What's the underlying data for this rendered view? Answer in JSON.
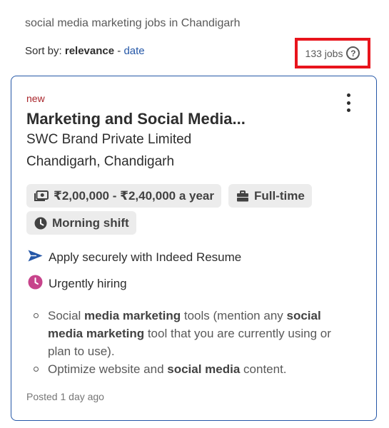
{
  "search": {
    "query": "social media marketing jobs in Chandigarh"
  },
  "sort": {
    "prefix": "Sort by:",
    "active": "relevance",
    "separator": "-",
    "alt": "date"
  },
  "results": {
    "count_label": "133 jobs",
    "help_glyph": "?"
  },
  "highlight_color": "#e8141c",
  "card": {
    "new_label": "new",
    "title": "Marketing and Social Media...",
    "company": "SWC Brand Private Limited",
    "location": "Chandigarh, Chandigarh",
    "tags": {
      "salary": "₹2,00,000 - ₹2,40,000 a year",
      "job_type": "Full-time",
      "shift": "Morning shift"
    },
    "features": {
      "apply": "Apply securely with Indeed Resume",
      "urgent": "Urgently hiring"
    },
    "snippet": {
      "item1": [
        "Social ",
        "media marketing",
        " tools (mention any ",
        "social media marketing",
        " tool that you are currently using or plan to use)."
      ],
      "item2": [
        "Optimize website and ",
        "social media",
        " content."
      ]
    },
    "posted": "Posted 1 day ago",
    "icons": {
      "salary": "money-icon",
      "job_type": "briefcase-icon",
      "shift": "clock-icon",
      "apply": "send-arrow-icon",
      "urgent": "urgent-clock-icon",
      "menu": "more-vertical-icon"
    }
  },
  "colors": {
    "link": "#2557a7",
    "new": "#a9252b",
    "urgent": "#c7438b",
    "card_border": "#2557a7"
  }
}
